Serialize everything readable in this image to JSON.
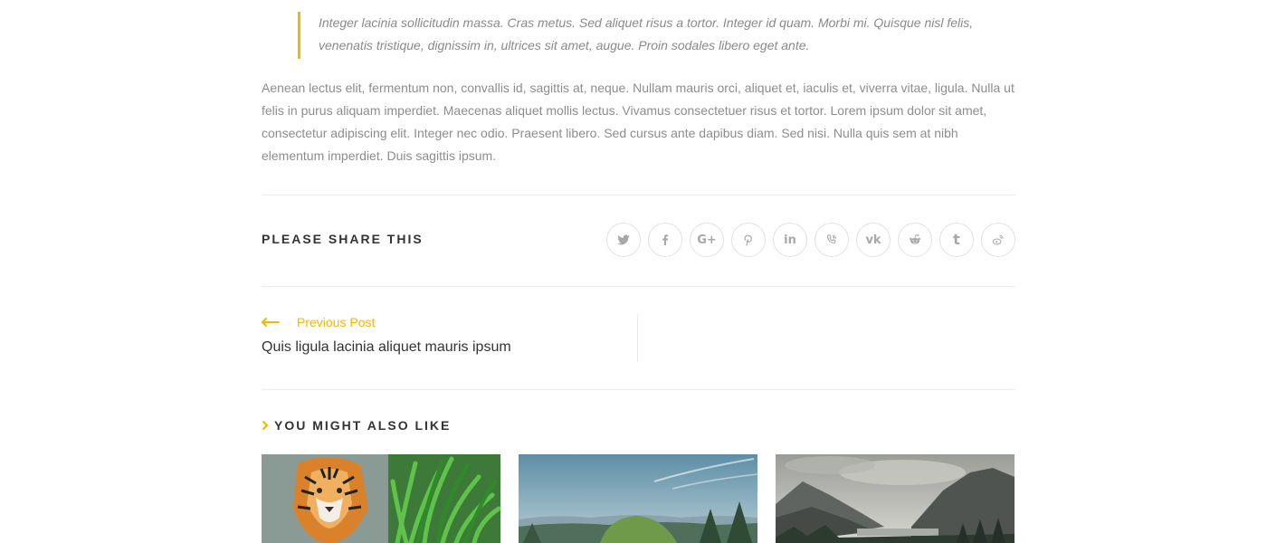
{
  "article": {
    "blockquote": "Integer lacinia sollicitudin massa. Cras metus. Sed aliquet risus a tortor. Integer id quam. Morbi mi. Quisque nisl felis, venenatis tristique, dignissim in, ultrices sit amet, augue. Proin sodales libero eget ante.",
    "paragraph": "Aenean lectus elit, fermentum non, convallis id, sagittis at, neque. Nullam mauris orci, aliquet et, iaculis et, viverra vitae, ligula. Nulla ut felis in purus aliquam imperdiet. Maecenas aliquet mollis lectus. Vivamus consectetuer risus et tortor. Lorem ipsum dolor sit amet, consectetur adipiscing elit. Integer nec odio. Praesent libero. Sed cursus ante dapibus diam. Sed nisi. Nulla quis sem at nibh elementum imperdiet. Duis sagittis ipsum."
  },
  "share": {
    "heading": "PLEASE SHARE THIS",
    "buttons": [
      {
        "icon": "twitter-icon"
      },
      {
        "icon": "facebook-icon"
      },
      {
        "icon": "google-plus-icon",
        "glyph": "G+"
      },
      {
        "icon": "pinterest-icon"
      },
      {
        "icon": "linkedin-icon",
        "glyph": "in"
      },
      {
        "icon": "viber-icon"
      },
      {
        "icon": "vk-icon",
        "glyph": "vk"
      },
      {
        "icon": "reddit-icon"
      },
      {
        "icon": "tumblr-icon",
        "glyph": "t"
      },
      {
        "icon": "weibo-icon"
      }
    ]
  },
  "post_nav": {
    "previous_label": "Previous Post",
    "previous_title": "Quis ligula lacinia aliquet mauris ipsum"
  },
  "related": {
    "heading": "YOU MIGHT ALSO LIKE",
    "items": [
      {
        "image": "tiger-photo"
      },
      {
        "image": "forest-hills-photo"
      },
      {
        "image": "mountain-lake-photo"
      }
    ]
  },
  "colors": {
    "accent": "#f2b705",
    "text": "#333333",
    "muted": "#8d8d8d",
    "border": "#ececec",
    "icon": "#a8a8a8"
  }
}
